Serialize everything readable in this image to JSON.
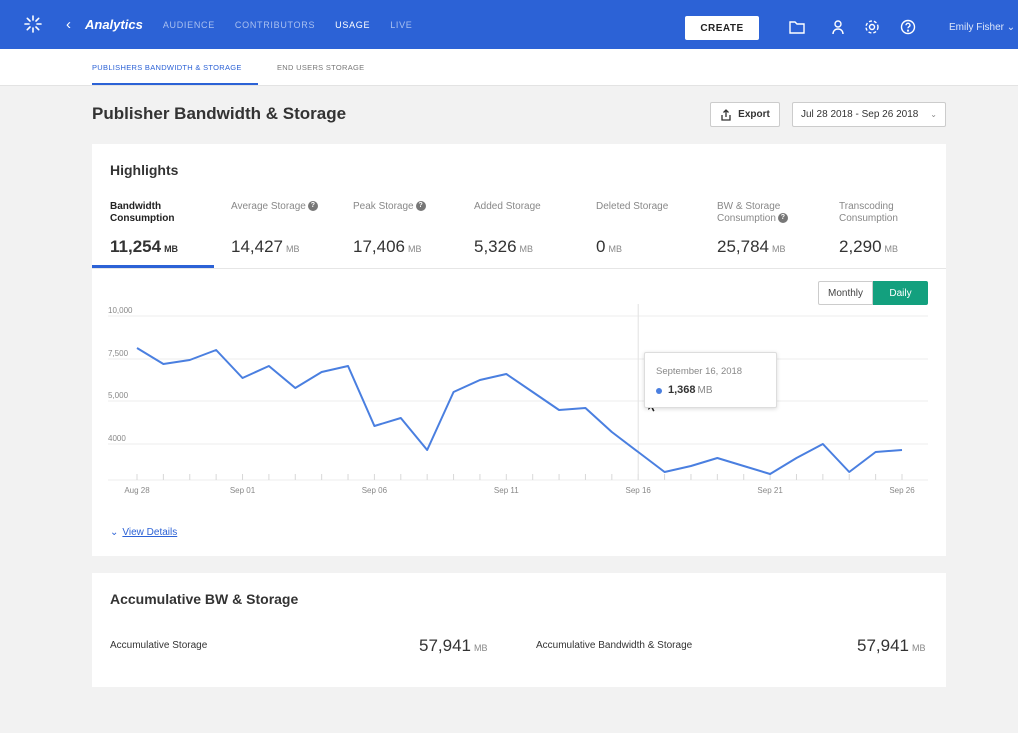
{
  "topbar": {
    "app_title": "Analytics",
    "nav": [
      "AUDIENCE",
      "CONTRIBUTORS",
      "USAGE",
      "LIVE"
    ],
    "active_nav": "USAGE",
    "create_label": "CREATE",
    "icons": [
      "folder-icon",
      "person-icon",
      "gear-icon",
      "help-icon"
    ],
    "user_name": "Emily Fisher",
    "bar_color": "#2c62d6"
  },
  "subtabs": [
    "PUBLISHERS BANDWIDTH & STORAGE",
    "END USERS STORAGE"
  ],
  "page": {
    "title": "Publisher Bandwidth & Storage",
    "export_label": "Export",
    "date_range": "Jul 28 2018 - Sep 26 2018"
  },
  "highlights": {
    "title": "Highlights",
    "stats": [
      {
        "label": "Bandwidth Consumption",
        "value": "11,254",
        "unit": "MB",
        "help": false,
        "active": true
      },
      {
        "label": "Average Storage",
        "value": "14,427",
        "unit": "MB",
        "help": true
      },
      {
        "label": "Peak Storage",
        "value": "17,406",
        "unit": "MB",
        "help": true
      },
      {
        "label": "Added Storage",
        "value": "5,326",
        "unit": "MB",
        "help": false
      },
      {
        "label": "Deleted Storage",
        "value": "0",
        "unit": "MB",
        "help": false
      },
      {
        "label": "BW & Storage Consumption",
        "value": "25,784",
        "unit": "MB",
        "help": true
      },
      {
        "label": "Transcoding Consumption",
        "value": "2,290",
        "unit": "MB",
        "help": false
      }
    ],
    "toggle": {
      "monthly": "Monthly",
      "daily": "Daily",
      "active": "Daily",
      "active_color": "#13a07e"
    },
    "tooltip": {
      "date": "September 16, 2018",
      "value": "1,368",
      "unit": "MB"
    },
    "view_details": "View Details"
  },
  "chart_data": {
    "type": "line",
    "y_tick_labels": [
      "10,000",
      "7,500",
      "5,000",
      "4000"
    ],
    "x_tick_labels": [
      "Aug 28",
      "Sep 01",
      "Sep 06",
      "Sep 11",
      "Sep 16",
      "Sep 21",
      "Sep 26"
    ],
    "x": [
      "Aug 28",
      "Aug 29",
      "Aug 30",
      "Aug 31",
      "Sep 01",
      "Sep 02",
      "Sep 03",
      "Sep 04",
      "Sep 05",
      "Sep 06",
      "Sep 07",
      "Sep 08",
      "Sep 09",
      "Sep 10",
      "Sep 11",
      "Sep 12",
      "Sep 13",
      "Sep 14",
      "Sep 15",
      "Sep 16",
      "Sep 17",
      "Sep 18",
      "Sep 19",
      "Sep 20",
      "Sep 21",
      "Sep 22",
      "Sep 23",
      "Sep 24",
      "Sep 25",
      "Sep 26"
    ],
    "values": [
      8400,
      7600,
      7800,
      8300,
      6900,
      7500,
      6400,
      7200,
      7500,
      4500,
      4900,
      3300,
      6200,
      6800,
      7100,
      6200,
      5300,
      5400,
      4200,
      3200,
      2200,
      2500,
      2900,
      2500,
      2100,
      2900,
      3600,
      2200,
      3200,
      3300
    ],
    "series_color": "#4a7fe0",
    "highlight_index": 19,
    "grid": true
  },
  "accum": {
    "title": "Accumulative BW & Storage",
    "items": [
      {
        "label": "Accumulative Storage",
        "value": "57,941",
        "unit": "MB"
      },
      {
        "label": "Accumulative Bandwidth & Storage",
        "value": "57,941",
        "unit": "MB"
      }
    ]
  }
}
